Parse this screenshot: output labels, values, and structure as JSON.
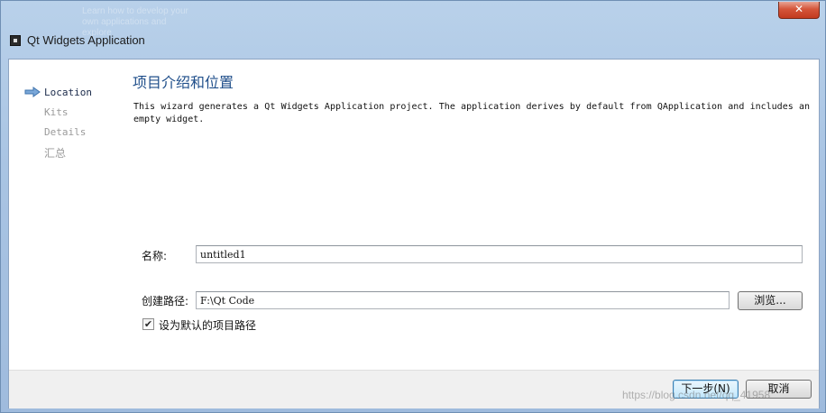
{
  "background_ghost_text": "Learn how to develop your\nown applications and\nexplore",
  "window": {
    "title": "Qt Widgets Application",
    "close_symbol": "✕"
  },
  "steps": [
    {
      "label": "Location",
      "active": true
    },
    {
      "label": "Kits",
      "active": false
    },
    {
      "label": "Details",
      "active": false
    },
    {
      "label": "汇总",
      "active": false
    }
  ],
  "page": {
    "heading": "项目介绍和位置",
    "description": "This wizard generates a Qt Widgets Application project. The application derives by default from QApplication and includes an empty widget."
  },
  "form": {
    "name_label": "名称:",
    "name_value": "untitled1",
    "path_label": "创建路径:",
    "path_value": "F:\\Qt Code",
    "browse_label": "浏览...",
    "default_checkbox_label": "设为默认的项目路径",
    "default_checked": true
  },
  "buttons": {
    "next": "下一步(N)",
    "cancel": "取消"
  },
  "watermark": "https://blog.csdn.net/qq_41958"
}
